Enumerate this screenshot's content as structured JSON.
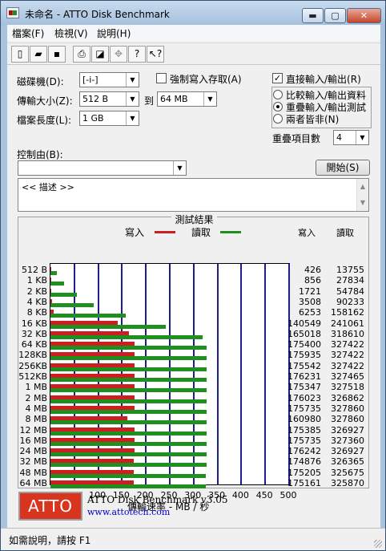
{
  "window": {
    "title": "未命名 - ATTO Disk Benchmark",
    "min": "▬",
    "max": "▢",
    "close": "✕"
  },
  "menu": [
    "檔案(F)",
    "檢視(V)",
    "說明(H)"
  ],
  "toolbar": {
    "new": "▯",
    "open": "▰",
    "save": "▪",
    "print": "⎙",
    "preview": "◪",
    "move": "✥",
    "help": "?",
    "context_help": "↖?"
  },
  "settings": {
    "drive_label": "磁碟機(D):",
    "drive_value": "[-i-]",
    "transfer_label": "傳輸大小(Z):",
    "transfer_from": "512 B",
    "to_label": "到",
    "transfer_to": "64 MB",
    "length_label": "檔案長度(L):",
    "length_value": "1 GB",
    "force_write_label": "強制寫入存取(A)",
    "force_write_checked": "",
    "direct_io_label": "直接輸入/輸出(R)",
    "direct_io_checked": "✓",
    "radio_compare": "比較輸入/輸出資料",
    "radio_overlap": "重疊輸入/輸出測試",
    "radio_neither": "兩者皆非(N)",
    "queue_label": "重疊項目數",
    "queue_value": "4",
    "control_label": "控制由(B):",
    "control_value": "",
    "start_button": "開始(S)"
  },
  "description": {
    "text": "<< 描述 >>"
  },
  "results": {
    "title": "測試結果",
    "legend_write": "寫入",
    "legend_read": "讀取",
    "col_write": "寫入",
    "col_read": "讀取",
    "xlabel": "傳輸速率 - MB / 秒"
  },
  "chart_data": {
    "type": "bar",
    "title": "測試結果",
    "xlabel": "傳輸速率 - MB / 秒",
    "xlim": [
      0,
      500
    ],
    "xticks": [
      "0",
      "50",
      "100",
      "150",
      "200",
      "250",
      "300",
      "350",
      "400",
      "450",
      "500"
    ],
    "categories": [
      "512 B",
      "1 KB",
      "2 KB",
      "4 KB",
      "8 KB",
      "16 KB",
      "32 KB",
      "64 KB",
      "128KB",
      "256KB",
      "512KB",
      "1 MB",
      "2 MB",
      "4 MB",
      "8 MB",
      "12 MB",
      "16 MB",
      "24 MB",
      "32 MB",
      "48 MB",
      "64 MB"
    ],
    "series": [
      {
        "name": "寫入",
        "color": "#cc1f1f",
        "values": [
          426,
          856,
          1721,
          3508,
          6253,
          140549,
          165018,
          175400,
          175935,
          175542,
          176231,
          175347,
          176023,
          175735,
          160980,
          175385,
          175735,
          176242,
          174876,
          175205,
          175161
        ]
      },
      {
        "name": "讀取",
        "color": "#1f8f1f",
        "values": [
          13755,
          27834,
          54784,
          90233,
          158162,
          241061,
          318610,
          327422,
          327422,
          327422,
          327465,
          327518,
          326862,
          327860,
          327860,
          326927,
          327360,
          326927,
          326365,
          325675,
          325870
        ]
      }
    ],
    "grid": true,
    "legend": "top"
  },
  "footer": {
    "logo": "ATTO",
    "product": "ATTO Disk Benchmark v3.05",
    "url": "www.attotech.com"
  },
  "status": {
    "text": "如需說明，請按 F1"
  }
}
